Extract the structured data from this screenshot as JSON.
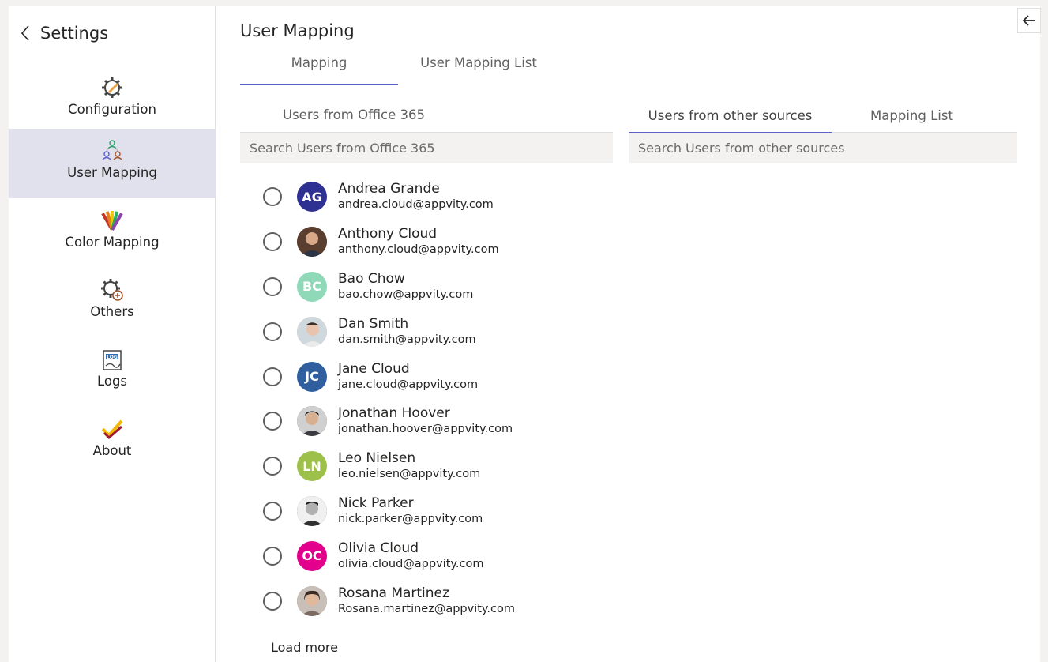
{
  "sidebar": {
    "title": "Settings",
    "items": [
      {
        "label": "Configuration",
        "icon": "gear-wrench-icon"
      },
      {
        "label": "User Mapping",
        "icon": "user-mapping-icon",
        "active": true
      },
      {
        "label": "Color Mapping",
        "icon": "color-palette-icon"
      },
      {
        "label": "Others",
        "icon": "gear-plus-icon"
      },
      {
        "label": "Logs",
        "icon": "log-icon"
      },
      {
        "label": "About",
        "icon": "checkmarks-icon"
      }
    ]
  },
  "main": {
    "title": "User Mapping",
    "tabs": [
      {
        "label": "Mapping",
        "active": true
      },
      {
        "label": "User Mapping List",
        "active": false
      }
    ],
    "left_panel": {
      "tab_label": "Users from Office 365",
      "search_placeholder": "Search Users from Office 365",
      "users": [
        {
          "name": "Andrea Grande",
          "email": "andrea.cloud@appvity.com",
          "initials": "AG",
          "color": "#2e3192"
        },
        {
          "name": "Anthony Cloud",
          "email": "anthony.cloud@appvity.com",
          "initials": "",
          "color": "#7a5a48"
        },
        {
          "name": "Bao Chow",
          "email": "bao.chow@appvity.com",
          "initials": "BC",
          "color": "#8fd8b8"
        },
        {
          "name": "Dan Smith",
          "email": "dan.smith@appvity.com",
          "initials": "",
          "color": "#b8b0a8"
        },
        {
          "name": "Jane Cloud",
          "email": "jane.cloud@appvity.com",
          "initials": "JC",
          "color": "#2f5f9e"
        },
        {
          "name": "Jonathan Hoover",
          "email": "jonathan.hoover@appvity.com",
          "initials": "",
          "color": "#4a4038"
        },
        {
          "name": "Leo Nielsen",
          "email": "leo.nielsen@appvity.com",
          "initials": "LN",
          "color": "#9cc04a"
        },
        {
          "name": "Nick Parker",
          "email": "nick.parker@appvity.com",
          "initials": "",
          "color": "#3a3a3a"
        },
        {
          "name": "Olivia Cloud",
          "email": "olivia.cloud@appvity.com",
          "initials": "OC",
          "color": "#e3008c"
        },
        {
          "name": "Rosana Martinez",
          "email": "Rosana.martinez@appvity.com",
          "initials": "",
          "color": "#6b5a50"
        }
      ],
      "load_more": "Load more"
    },
    "right_panel": {
      "tabs": [
        {
          "label": "Users from other sources",
          "active": true
        },
        {
          "label": "Mapping List",
          "active": false
        }
      ],
      "search_placeholder": "Search Users from other sources"
    }
  },
  "colors": {
    "accent": "#5b5fc7",
    "active_nav_bg": "#e1e1ee"
  }
}
